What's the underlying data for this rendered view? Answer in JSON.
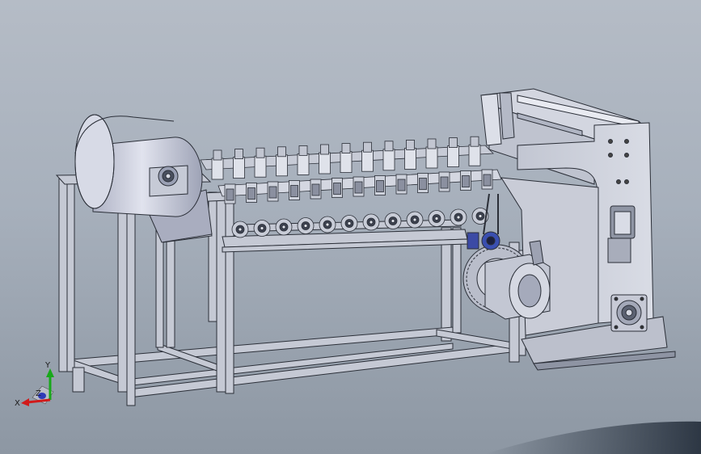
{
  "view": {
    "background_top": "#b5bcc6",
    "background_bottom": "#8d97a3",
    "model_color": "#c9cdd8",
    "edge_color": "#2b2f38"
  },
  "triad": {
    "x_label": "X",
    "y_label": "Y",
    "z_label": "Z",
    "x_color": "#d11a1a",
    "y_color": "#18a81a",
    "z_color": "#2f3bb8"
  },
  "model": {
    "parts": [
      "supply-roll",
      "roll-stand-frame",
      "base-frame",
      "knife-holders",
      "lower-rollers",
      "side-housing",
      "drive-motor",
      "drive-gear",
      "bearing-block"
    ]
  }
}
